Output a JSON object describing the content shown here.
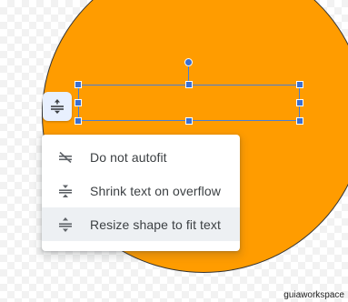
{
  "colors": {
    "shape_fill": "#ff9c00",
    "selection": "#3b6fd0",
    "menu_text": "#3c4043",
    "menu_icon": "#5f6368",
    "selected_item_bg": "#edf0f3"
  },
  "autofit_button": {
    "icon": "resize-shape-to-fit-icon"
  },
  "menu": {
    "items": [
      {
        "label": "Do not autofit",
        "icon": "do-not-autofit-icon",
        "selected": false
      },
      {
        "label": "Shrink text on overflow",
        "icon": "shrink-text-icon",
        "selected": false
      },
      {
        "label": "Resize shape to fit text",
        "icon": "resize-shape-to-fit-icon",
        "selected": true
      }
    ]
  },
  "watermark": "guiaworkspace"
}
